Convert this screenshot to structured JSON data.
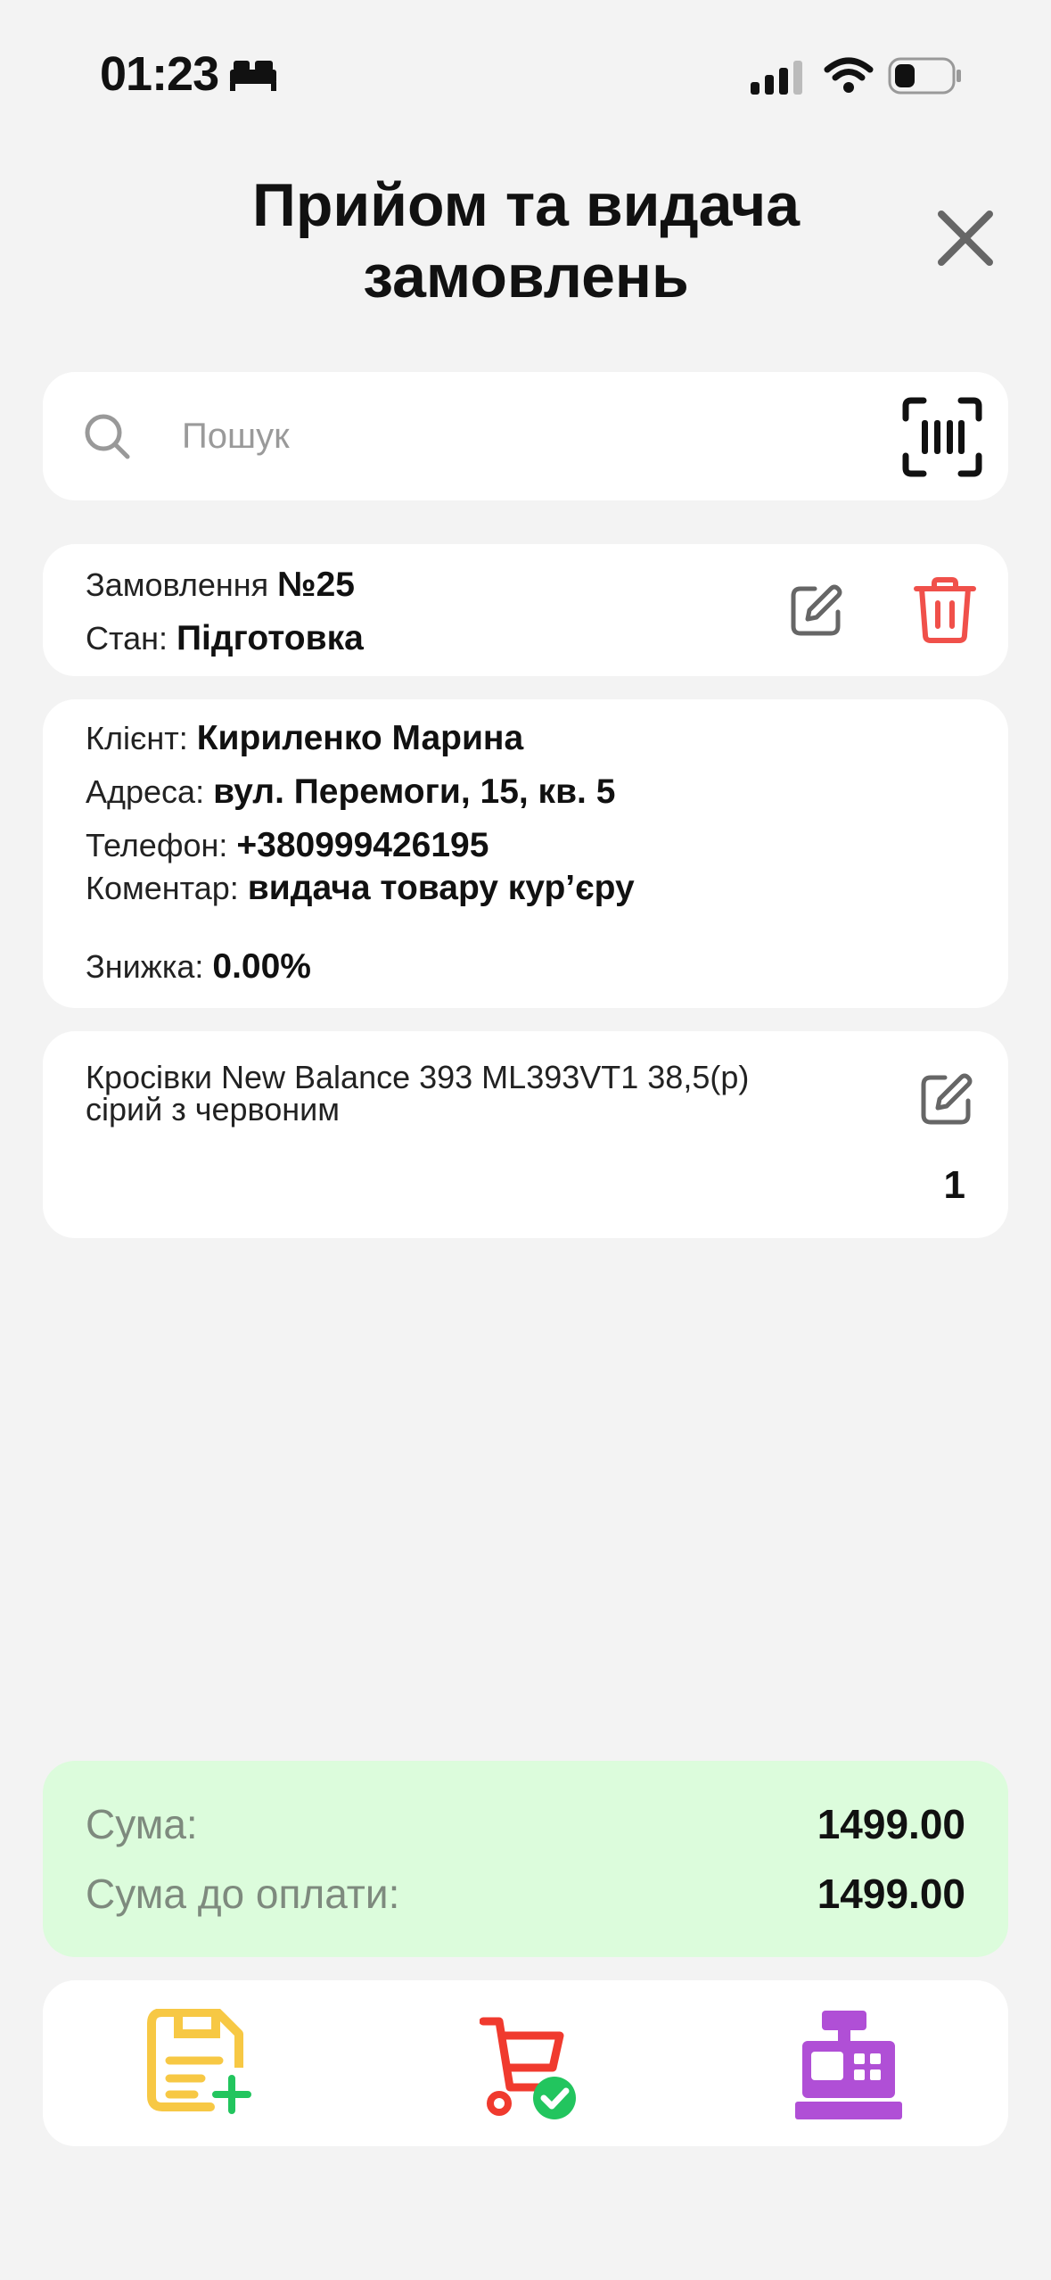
{
  "status_bar": {
    "time": "01:23",
    "icons": [
      "bed-icon",
      "signal-icon",
      "wifi-icon",
      "battery-icon"
    ]
  },
  "header": {
    "title": "Прийом та видача замовлень",
    "close_icon": "close-icon"
  },
  "search": {
    "placeholder": "Пошук",
    "search_icon": "search-icon",
    "scan_icon": "barcode-scan-icon"
  },
  "order": {
    "label": "Замовлення",
    "number": "№25",
    "status_label": "Стан:",
    "status_value": "Підготовка"
  },
  "client": {
    "client_label": "Клієнт:",
    "client_value": "Кириленко Марина",
    "address_label": "Адреса:",
    "address_value": "вул. Перемоги, 15, кв. 5",
    "phone_label": "Телефон:",
    "phone_value": "+380999426195",
    "comment_label": "Коментар:",
    "comment_value": "видача товару кур’єру",
    "discount_label": "Знижка:",
    "discount_value": "0.00%"
  },
  "items": [
    {
      "name_line1": "Кросівки New Balance 393 ML393VT1 38,5(р)",
      "name_line2": "сірий з червоним",
      "qty": "1"
    }
  ],
  "totals": {
    "sum_label": "Сума:",
    "sum_value": "1499.00",
    "due_label": "Сума до оплати:",
    "due_value": "1499.00"
  },
  "actions": [
    {
      "icon": "add-document-icon",
      "color": "#f7c844"
    },
    {
      "icon": "cart-check-icon",
      "color": "#f03a2e"
    },
    {
      "icon": "cash-register-icon",
      "color": "#b04fd6"
    }
  ],
  "colors": {
    "background": "#f3f3f3",
    "totals_bg": "#dcfcdc",
    "delete": "#f0504a",
    "accent_green": "#22c55e"
  }
}
